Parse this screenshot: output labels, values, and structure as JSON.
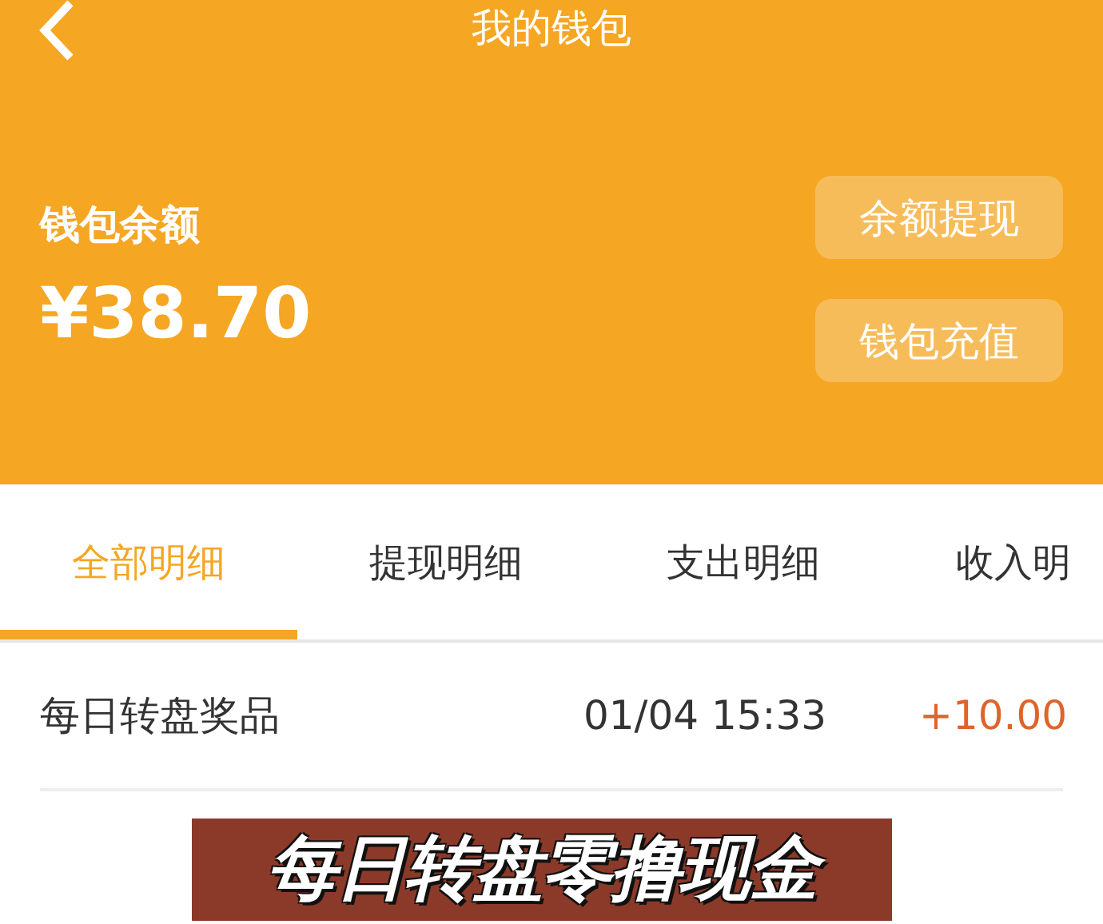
{
  "header": {
    "back_icon": true,
    "title": "我的钱包",
    "balance_label": "钱包余额",
    "balance": "¥38.70",
    "buttons": [
      "余额提现",
      "钱包充值"
    ]
  },
  "tabs": [
    {
      "label": "全部明细",
      "selected": true
    },
    {
      "label": "提现明细",
      "selected": false
    },
    {
      "label": "支出明细",
      "selected": false
    },
    {
      "label": "收入明",
      "selected": false
    }
  ],
  "records": [
    {
      "name": "每日转盘奖品",
      "time": "01/04 15:33",
      "amount": "+10.00"
    }
  ],
  "banner": {
    "text": "每日转盘零撸现金"
  }
}
